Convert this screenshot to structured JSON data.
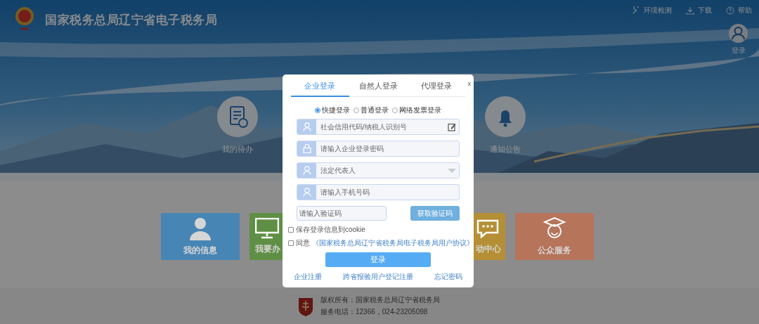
{
  "header": {
    "title": "国家税务总局辽宁省电子税务局",
    "tools": [
      {
        "kind": "wrench",
        "label": "环境检测"
      },
      {
        "kind": "download",
        "label": "下载"
      },
      {
        "kind": "help",
        "label": "帮助"
      }
    ],
    "user_label": "登录"
  },
  "hero_items": [
    {
      "kind": "todo",
      "label": "我的待办"
    },
    {
      "kind": "bell",
      "label": "通知公告"
    }
  ],
  "tiles": [
    {
      "kind": "user",
      "label": "我的信息",
      "color": "#4785b5"
    },
    {
      "kind": "monitor",
      "label": "我要办",
      "color": "#5f8f45"
    },
    {
      "kind": "chat",
      "label": "动中心",
      "color": "#b58f35"
    },
    {
      "kind": "service",
      "label": "公众服务",
      "color": "#b6745a"
    }
  ],
  "footer": {
    "lines": [
      "版权所有：国家税务总局辽宁省税务局",
      "服务电话：12366，024-23205098"
    ]
  },
  "dialog": {
    "close": "x",
    "tabs": [
      {
        "label": "企业登录",
        "selected": true
      },
      {
        "label": "自然人登录",
        "selected": false
      },
      {
        "label": "代理登录",
        "selected": false
      }
    ],
    "modes": [
      {
        "label": "快捷登录",
        "selected": true
      },
      {
        "label": "普通登录",
        "selected": false
      },
      {
        "label": "网络发票登录",
        "selected": false
      }
    ],
    "fields": [
      {
        "kind": "id",
        "placeholder": "社会信用代码/纳税人识别号"
      },
      {
        "kind": "password",
        "placeholder": "请输入企业登录密码"
      },
      {
        "kind": "select",
        "placeholder": "法定代表人"
      },
      {
        "kind": "phone",
        "placeholder": "请输入手机号码"
      }
    ],
    "code_placeholder": "请输入验证码",
    "code_button": "获取验证码",
    "checks": [
      {
        "label": "保存登录信息到cookie",
        "checked": false
      },
      {
        "label": "同意",
        "link": "《国家税务总局辽宁省税务局电子税务局用户协议》",
        "checked": false
      }
    ],
    "submit": "登录",
    "links": [
      "企业注册",
      "跨省报验用户登记注册",
      "忘记密码"
    ]
  }
}
